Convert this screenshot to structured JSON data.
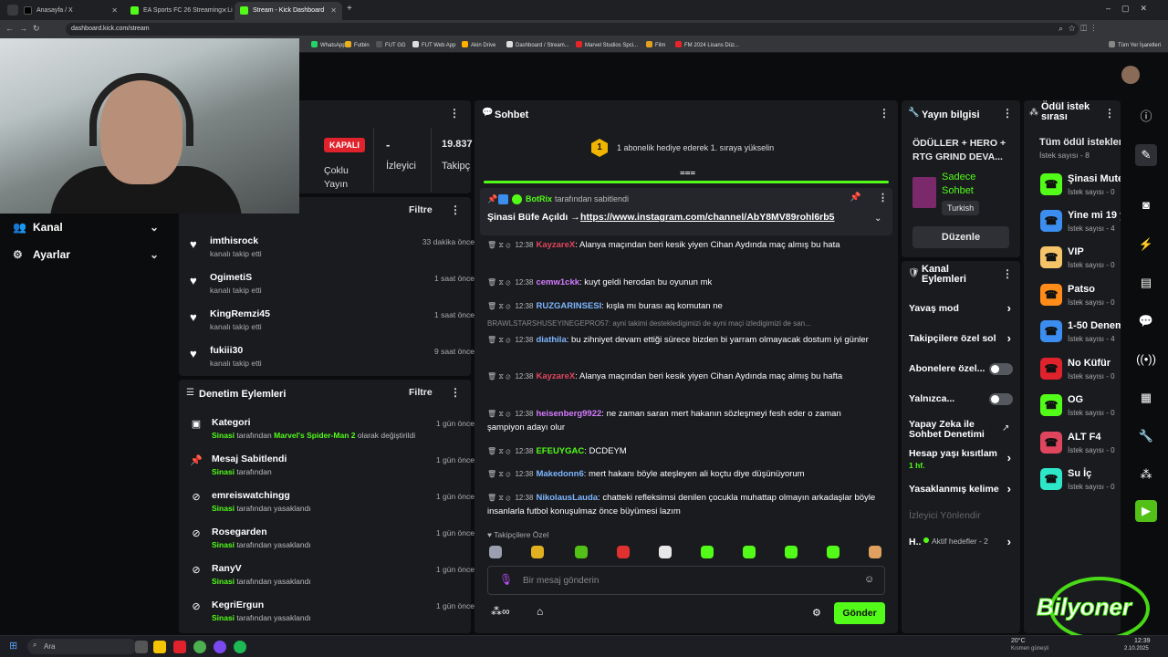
{
  "browser": {
    "tabs": [
      {
        "title": "Anasayfa / X",
        "icon_color": "#000000"
      },
      {
        "title": "EA Sports FC 26 Streaming - Li",
        "icon_color": "#53fc18"
      },
      {
        "title": "Stream - Kick Dashboard",
        "icon_color": "#53fc18"
      }
    ],
    "url": "dashboard.kick.com/stream",
    "bookmarks": [
      "WhatsApp",
      "Futbin",
      "FUT GG",
      "FUT Web App",
      "Akin Drive",
      "Dashboard / Stream...",
      "Marvel Studios Spci...",
      "Film",
      "FM 2024 Lisans Düz..."
    ],
    "all_bookmarks": "Tüm Yer İşaretleri"
  },
  "nav": {
    "kanal": "Kanal",
    "ayarlar": "Ayarlar"
  },
  "stream_status": {
    "state": "KAPALI",
    "multi": "Çoklu Yayın",
    "viewers_value": "-",
    "viewers_label": "İzleyici",
    "followers_value": "19.837",
    "followers_label": "Takipç"
  },
  "followers": {
    "filter": "Filtre",
    "items": [
      {
        "name": "imthisrock",
        "action": "kanalı takip etti",
        "time": "33 dakika önce"
      },
      {
        "name": "OgimetiS",
        "action": "kanalı takip etti",
        "time": "1 saat önce"
      },
      {
        "name": "KingRemzi45",
        "action": "kanalı takip etti",
        "time": "1 saat önce"
      },
      {
        "name": "fukiii30",
        "action": "kanalı takip etti",
        "time": "9 saat önce"
      }
    ]
  },
  "moderation": {
    "title": "Denetim Eylemleri",
    "filter": "Filtre",
    "items": [
      {
        "name": "Kategori",
        "user": "Sinasi",
        "mid": " tarafından ",
        "extra": "Marvel's Spider-Man 2",
        "tail": " olarak değiştirildi",
        "time": "1 gün önce",
        "icon": "category-icon"
      },
      {
        "name": "Mesaj Sabitlendi",
        "user": "Sinasi",
        "mid": " tarafından",
        "extra": "",
        "tail": "",
        "time": "1 gün önce",
        "icon": "pin-icon"
      },
      {
        "name": "emreiswatchingg",
        "user": "Sinasi",
        "mid": " tarafından yasaklandı",
        "extra": "",
        "tail": "",
        "time": "1 gün önce",
        "icon": "ban-icon"
      },
      {
        "name": "Rosegarden",
        "user": "Sinasi",
        "mid": " tarafından yasaklandı",
        "extra": "",
        "tail": "",
        "time": "1 gün önce",
        "icon": "ban-icon"
      },
      {
        "name": "RanyV",
        "user": "Sinasi",
        "mid": " tarafından yasaklandı",
        "extra": "",
        "tail": "",
        "time": "1 gün önce",
        "icon": "ban-icon"
      },
      {
        "name": "KegriErgun",
        "user": "Sinasi",
        "mid": " tarafından yasaklandı",
        "extra": "",
        "tail": "",
        "time": "1 gün önce",
        "icon": "ban-icon"
      }
    ]
  },
  "chat": {
    "title": "Sohbet",
    "goal_badge": "1",
    "goal_text": "1 abonelik hediye ederek 1. sıraya yükselin",
    "pinned_by": "BotRix",
    "pinned_suffix": "tarafından sabitlendi",
    "pinned_text": "Şinasi Büfe Açıldı → ",
    "pinned_link": "https://www.instagram.com/channel/AbY8MV89rohl6rb5",
    "reply_line": "BRAWLSTARSHUSEYINEGEPRO57: ayni takimi destekledigimizi de ayni maçi izledigimizi de san...",
    "messages": [
      {
        "time": "12:38",
        "user": "KayzareX",
        "color": "#e0455e",
        "text": ": Alanya maçından beri kesik yiyen Cihan Aydında maç almış bu hata"
      },
      {
        "time": "12:38",
        "user": "cemw1ckk",
        "color": "#d57cff",
        "text": ": kuyt geldi herodan bu oyunun mk"
      },
      {
        "time": "12:38",
        "user": "RUZGARINSESI",
        "color": "#7eb6ff",
        "text": ": kışla mı burası aq komutan ne"
      },
      {
        "time": "12:38",
        "user": "diathila",
        "color": "#7eb6ff",
        "text": ": bu zihniyet devam ettiği sürece bizden bi yarram olmayacak dostum iyi günler"
      },
      {
        "time": "12:38",
        "user": "KayzareX",
        "color": "#e0455e",
        "text": ": Alanya maçından beri kesik yiyen Cihan Aydında maç almış bu hafta"
      },
      {
        "time": "12:38",
        "user": "heisenberg9922",
        "color": "#d57cff",
        "text": ": ne zaman saran mert hakanın sözleşmeyi fesh eder o zaman şampiyon adayı olur"
      },
      {
        "time": "12:38",
        "user": "EFEUYGAC",
        "color": "#53fc18",
        "text": ": DCDEYM"
      },
      {
        "time": "12:38",
        "user": "Makedonn6",
        "color": "#7eb6ff",
        "text": ": mert hakanı böyle ateşleyen ali koçtu diye düşünüyorum"
      },
      {
        "time": "12:38",
        "user": "NikolausLauda",
        "color": "#7eb6ff",
        "text": ": chatteki refleksimsi denilen çocukla muhattap olmayın arkadaşlar böyle insanlarla futbol konuşulmaz önce büyümesi lazım"
      }
    ],
    "followers_only": "Takipçilere Özel",
    "placeholder": "Bir mesaj gönderin",
    "send": "Gönder"
  },
  "stream_info": {
    "title": "Yayın bilgisi",
    "stream_title": "ÖDÜLLER + HERO + RTG GRIND DEVA...",
    "category": "Sadece Sohbet",
    "language": "Turkish",
    "edit": "Düzenle"
  },
  "channel_actions": {
    "title": "Kanal Eylemleri",
    "rows": [
      {
        "label": "Yavaş mod",
        "type": "chevron"
      },
      {
        "label": "Takipçilere özel sol",
        "type": "chevron"
      },
      {
        "label": "Abonelere özel...",
        "type": "toggle"
      },
      {
        "label": "Yalnızca...",
        "type": "toggle"
      },
      {
        "label": "Yapay Zeka ile Sohbet Denetimi",
        "type": "link"
      },
      {
        "label": "Hesap yaşı kısıtlam",
        "sub": "1 hf.",
        "type": "chevron"
      },
      {
        "label": "Yasaklanmış kelime",
        "type": "chevron"
      },
      {
        "label": "İzleyici Yönlendir",
        "type": "disabled"
      },
      {
        "label": "H..",
        "sub": "Aktif hedefler - 2",
        "type": "chevron"
      }
    ]
  },
  "rewards": {
    "title": "Ödül istek sırası",
    "all": "Tüm ödül istekleri",
    "count": "İstek sayısı - 8",
    "items": [
      {
        "name": "Şinasi Mute",
        "sub": "İstek sayısı - 0",
        "color": "#53fc18"
      },
      {
        "name": "Yine mi 19 y",
        "sub": "İstek sayısı - 4",
        "color": "#3b8ef0"
      },
      {
        "name": "VIP",
        "sub": "İstek sayısı - 0",
        "color": "#f5c469"
      },
      {
        "name": "Patso",
        "sub": "İstek sayısı - 0",
        "color": "#ff8c1a"
      },
      {
        "name": "1-50 Denem",
        "sub": "İstek sayısı - 4",
        "color": "#3b8ef0"
      },
      {
        "name": "No Küfür",
        "sub": "İstek sayısı - 0",
        "color": "#e0222c"
      },
      {
        "name": "OG",
        "sub": "İstek sayısı - 0",
        "color": "#53fc18"
      },
      {
        "name": "ALT F4",
        "sub": "İstek sayısı - 0",
        "color": "#e0455e"
      },
      {
        "name": "Su İç",
        "sub": "İstek sayısı - 0",
        "color": "#2ee6c8"
      }
    ]
  },
  "overlay": {
    "brand": "Bilyoner"
  },
  "taskbar": {
    "search": "Ara",
    "weather_temp": "20°C",
    "weather_desc": "Kısmen güneşli",
    "time": "12:39",
    "date": "2.10.2025"
  }
}
